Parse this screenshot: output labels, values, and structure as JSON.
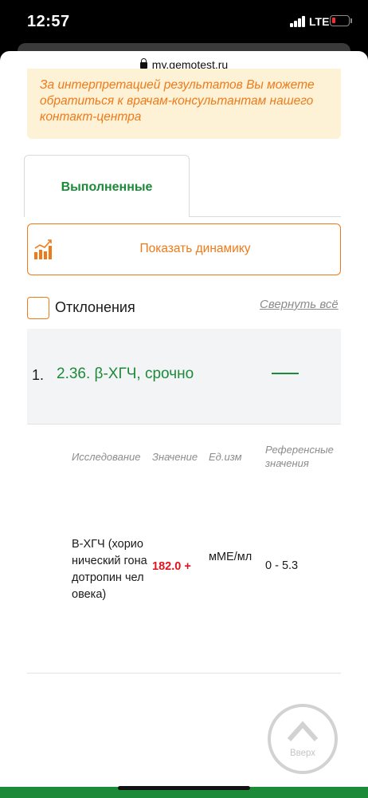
{
  "status_bar": {
    "time": "12:57",
    "network": "LTE"
  },
  "browser": {
    "url": "my.gemotest.ru"
  },
  "notice": {
    "text": "За интерпретацией результатов Вы можете обратиться к врачам-консультантам нашего контакт-центра"
  },
  "tabs": {
    "active": "Выполненные"
  },
  "dynamics_button": {
    "label": "Показать динамику"
  },
  "filters": {
    "deviations_label": "Отклонения",
    "deviations_checked": false,
    "collapse_all": "Свернуть всё"
  },
  "result": {
    "number": "1.",
    "title": "2.36. β-ХГЧ, срочно",
    "columns": {
      "test": "Исследование",
      "value": "Значение",
      "unit": "Ед.изм",
      "reference": "Референсные значения"
    },
    "row": {
      "test": "В-ХГЧ (хорионический гонадотропин человека)",
      "value": "182.0 +",
      "unit": "мМЕ/мл",
      "reference": "0 - 5.3"
    }
  },
  "scroll_up": {
    "label": "Вверх"
  },
  "colors": {
    "brand_green": "#1d8a3a",
    "accent_orange": "#f07a18",
    "alert_red": "#e0141e"
  }
}
